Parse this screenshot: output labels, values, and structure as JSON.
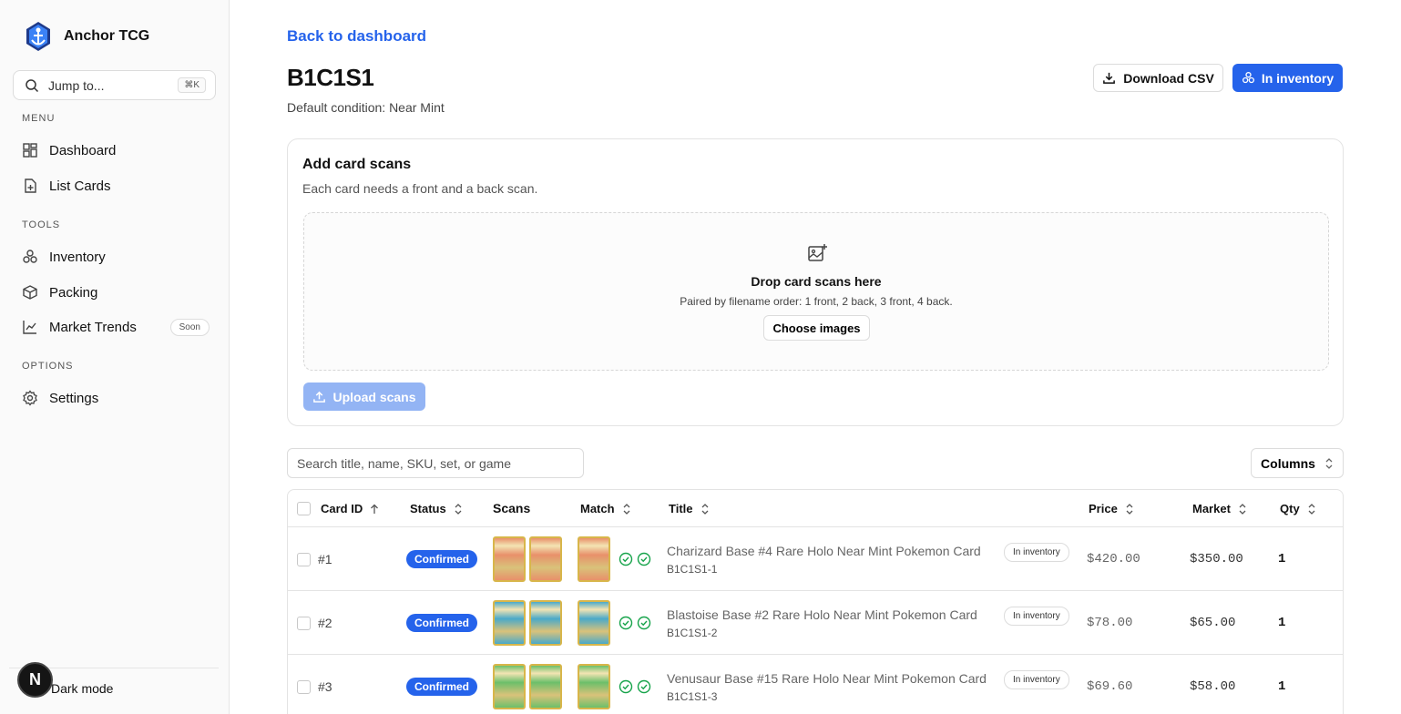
{
  "brand": {
    "name": "Anchor TCG"
  },
  "jump": {
    "placeholder": "Jump to...",
    "shortcut": "⌘K"
  },
  "sidebar": {
    "sections": [
      {
        "label": "MENU",
        "items": [
          {
            "label": "Dashboard",
            "icon": "dashboard-icon"
          },
          {
            "label": "List Cards",
            "icon": "list-cards-icon"
          }
        ]
      },
      {
        "label": "TOOLS",
        "items": [
          {
            "label": "Inventory",
            "icon": "inventory-icon"
          },
          {
            "label": "Packing",
            "icon": "package-icon"
          },
          {
            "label": "Market Trends",
            "icon": "trend-icon",
            "badge": "Soon"
          }
        ]
      },
      {
        "label": "OPTIONS",
        "items": [
          {
            "label": "Settings",
            "icon": "gear-icon"
          }
        ]
      }
    ],
    "dark_mode": "Dark mode",
    "avatar_initial": "N"
  },
  "header": {
    "back_link": "Back to dashboard",
    "title": "B1C1S1",
    "subtitle": "Default condition: Near Mint",
    "download_csv": "Download CSV",
    "in_inventory": "In inventory"
  },
  "upload_card": {
    "title": "Add card scans",
    "description": "Each card needs a front and a back scan.",
    "drop_title": "Drop card scans here",
    "drop_hint": "Paired by filename order: 1 front, 2 back, 3 front, 4 back.",
    "choose_button": "Choose images",
    "upload_button": "Upload scans"
  },
  "table_controls": {
    "search_placeholder": "Search title, name, SKU, set, or game",
    "columns_button": "Columns"
  },
  "table": {
    "headers": {
      "card_id": "Card ID",
      "status": "Status",
      "scans": "Scans",
      "match": "Match",
      "title": "Title",
      "price": "Price",
      "market": "Market",
      "qty": "Qty"
    },
    "rows": [
      {
        "id": "#1",
        "status": "Confirmed",
        "title": "Charizard Base #4 Rare Holo Near Mint Pokemon Card",
        "sku": "B1C1S1-1",
        "badge": "In inventory",
        "price": "$420.00",
        "market": "$350.00",
        "qty": "1",
        "scan_color": "#e8906a"
      },
      {
        "id": "#2",
        "status": "Confirmed",
        "title": "Blastoise Base #2 Rare Holo Near Mint Pokemon Card",
        "sku": "B1C1S1-2",
        "badge": "In inventory",
        "price": "$78.00",
        "market": "$65.00",
        "qty": "1",
        "scan_color": "#4aa9c9"
      },
      {
        "id": "#3",
        "status": "Confirmed",
        "title": "Venusaur Base #15 Rare Holo Near Mint Pokemon Card",
        "sku": "B1C1S1-3",
        "badge": "In inventory",
        "price": "$69.60",
        "market": "$58.00",
        "qty": "1",
        "scan_color": "#6cbf6a"
      }
    ]
  },
  "colors": {
    "accent": "#2563eb",
    "accent_disabled": "#93b4f4",
    "match_green": "#16a34a"
  }
}
